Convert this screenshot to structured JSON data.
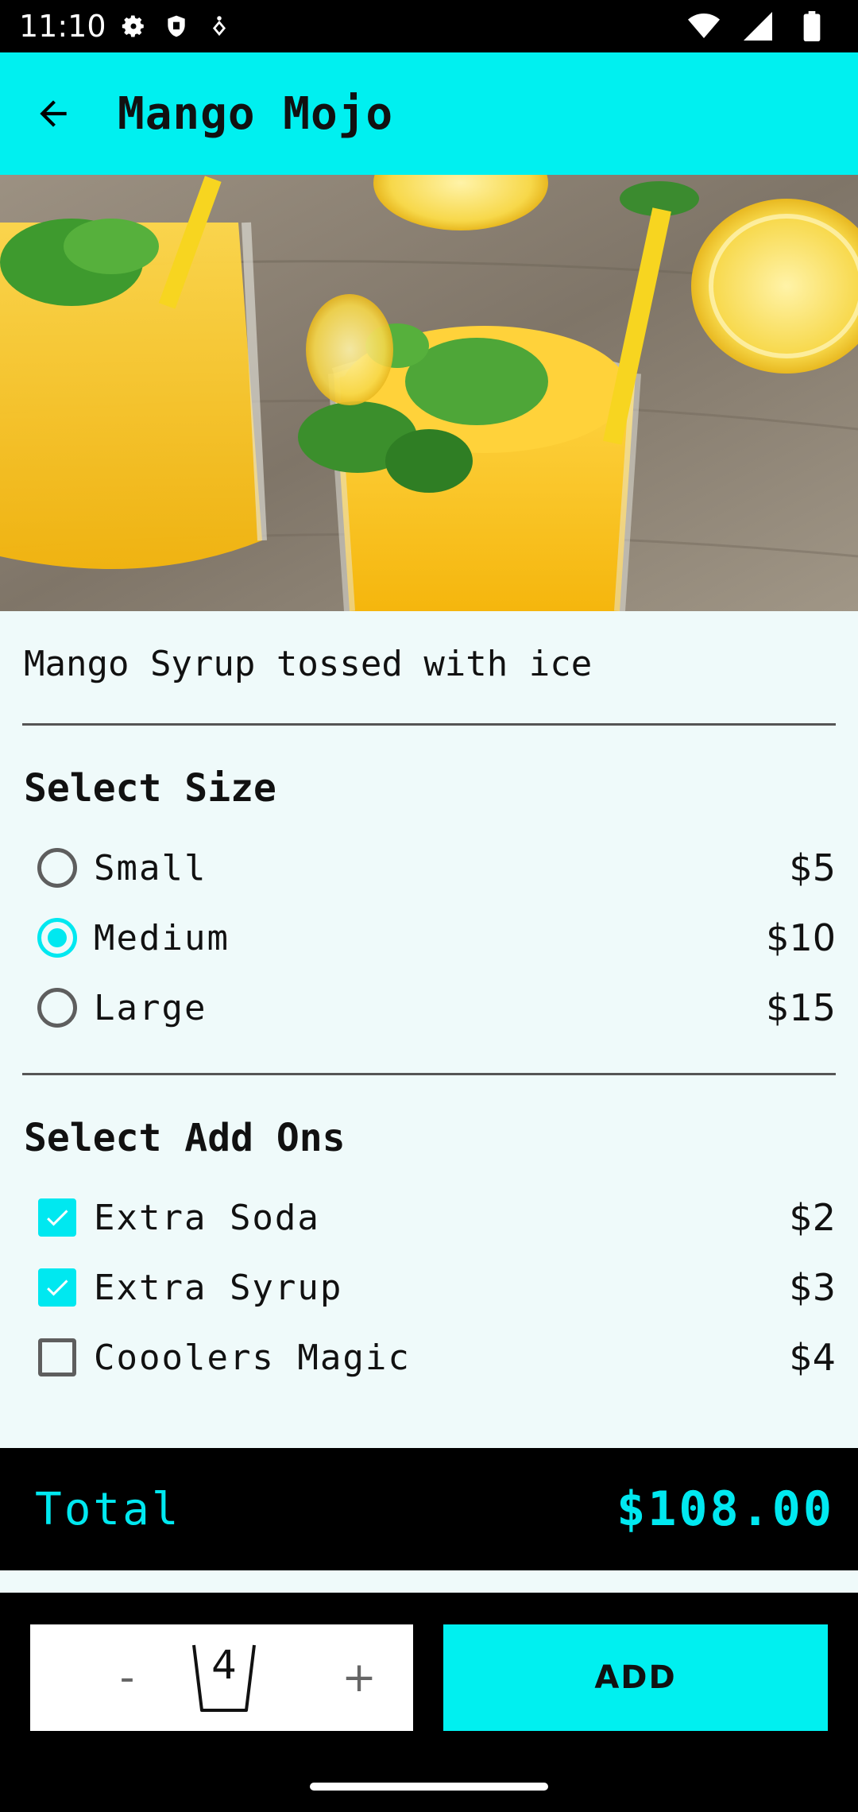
{
  "status_bar": {
    "time": "11:10"
  },
  "app_bar": {
    "title": "Mango Mojo"
  },
  "product": {
    "description": "Mango Syrup tossed with ice"
  },
  "size_section": {
    "title": "Select Size",
    "options": [
      {
        "label": "Small",
        "price": "$5",
        "selected": false
      },
      {
        "label": "Medium",
        "price": "$10",
        "selected": true
      },
      {
        "label": "Large",
        "price": "$15",
        "selected": false
      }
    ]
  },
  "addons_section": {
    "title": "Select Add Ons",
    "options": [
      {
        "label": "Extra Soda",
        "price": "$2",
        "checked": true
      },
      {
        "label": "Extra Syrup",
        "price": "$3",
        "checked": true
      },
      {
        "label": "Cooolers Magic",
        "price": "$4",
        "checked": false
      }
    ]
  },
  "total": {
    "label": "Total",
    "value": "$108.00"
  },
  "quantity": {
    "minus": "-",
    "value": "4",
    "plus": "+"
  },
  "add_button": {
    "label": "ADD"
  },
  "colors": {
    "accent": "#00f0f0",
    "dark": "#000000",
    "background": "#effafa"
  }
}
